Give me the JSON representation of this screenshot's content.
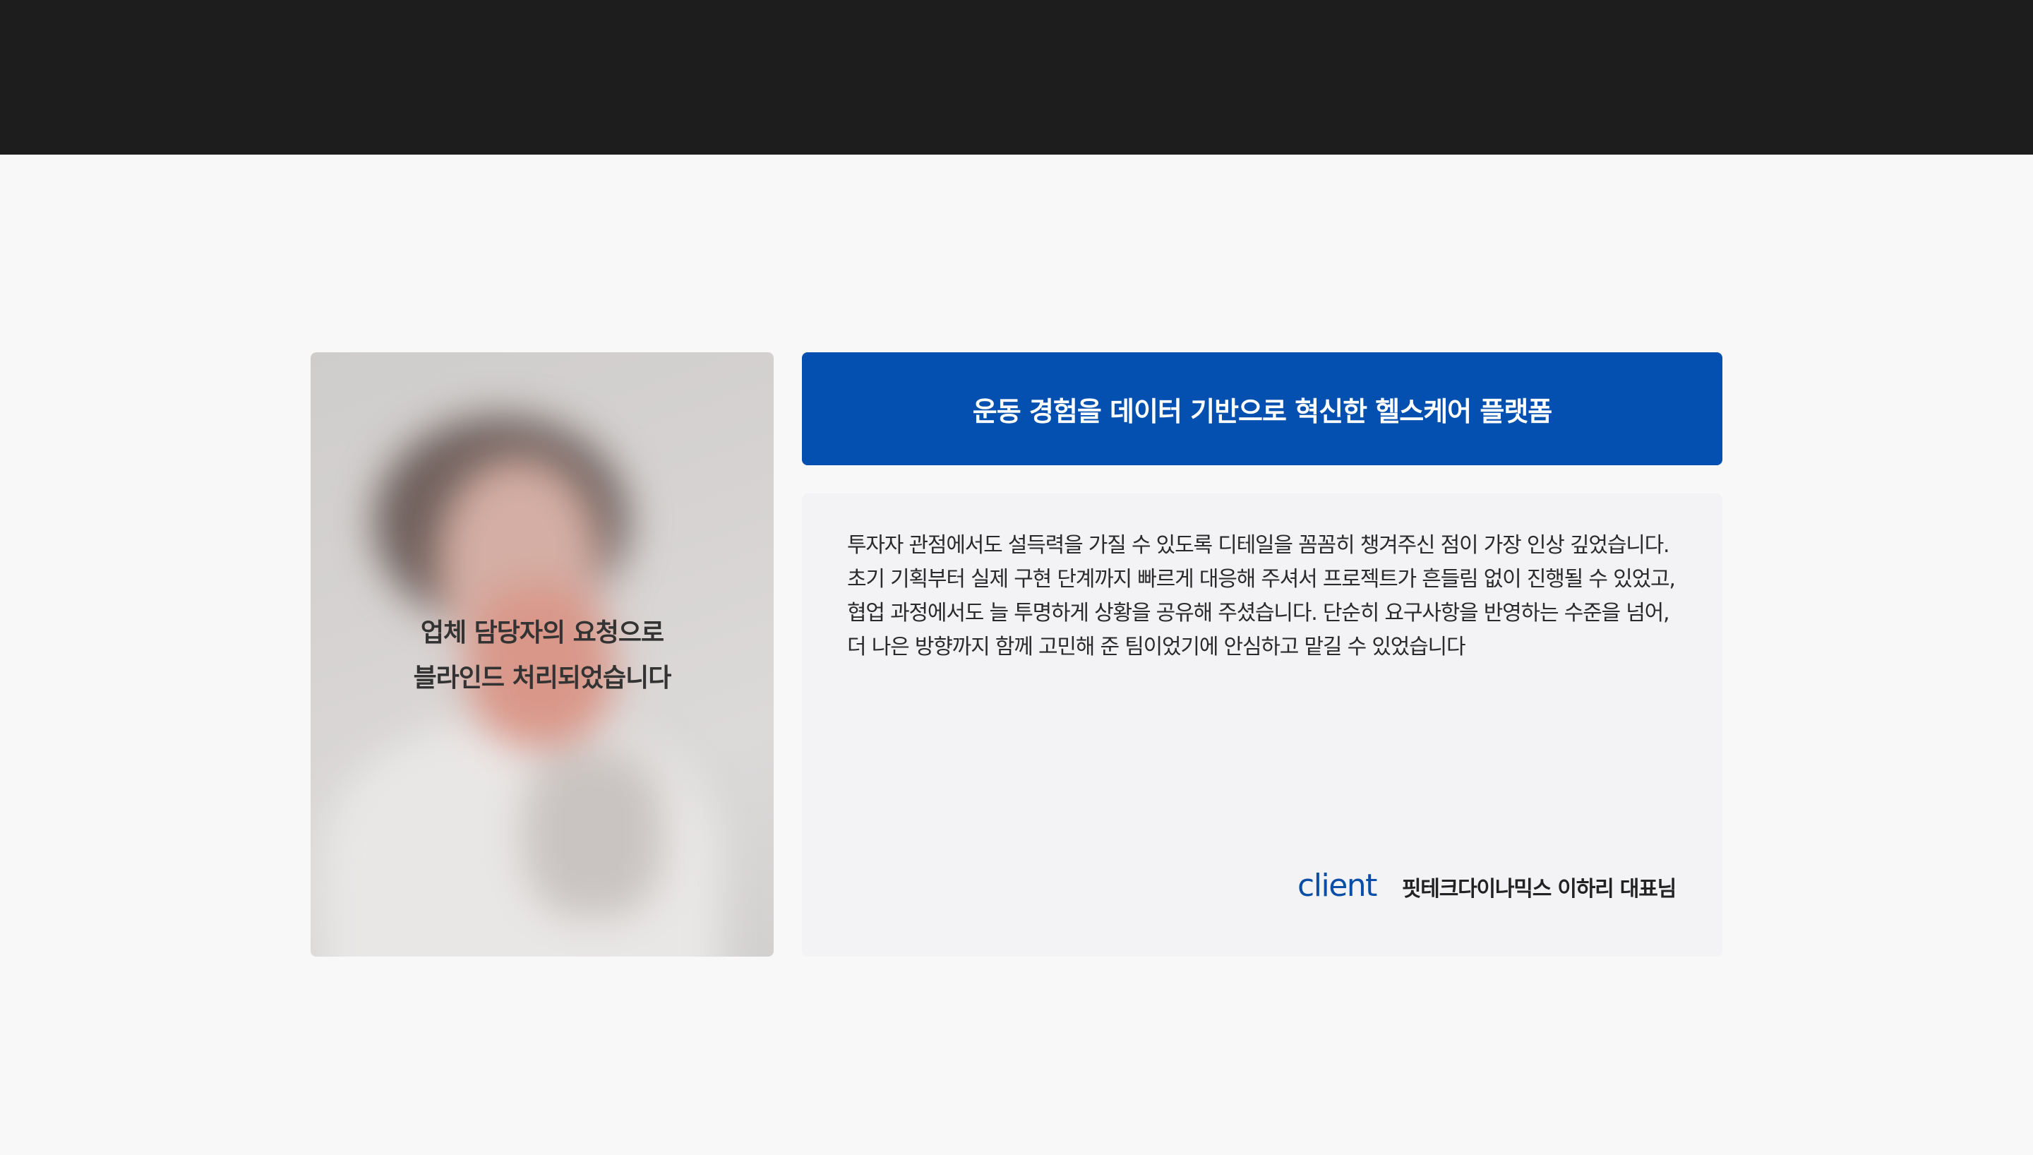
{
  "photo": {
    "notice_line1": "업체 담당자의 요청으로",
    "notice_line2": "블라인드 처리되었습니다"
  },
  "banner": {
    "title": "운동 경험을 데이터 기반으로 혁신한 헬스케어 플랫폼"
  },
  "review": {
    "lines": [
      "투자자 관점에서도 설득력을 가질 수 있도록 디테일을 꼼꼼히 챙겨주신 점이 가장 인상 깊었습니다.",
      "초기 기획부터 실제 구현 단계까지 빠르게 대응해 주셔서 프로젝트가 흔들림 없이 진행될 수 있었고,",
      "협업 과정에서도 늘 투명하게 상황을 공유해 주셨습니다. 단순히 요구사항을 반영하는 수준을 넘어,",
      "더 나은 방향까지 함께 고민해 준 팀이었기에 안심하고 맡길 수 있었습니다"
    ],
    "client_label": "client",
    "client_name": "핏테크다이나믹스 이하리 대표님"
  },
  "colors": {
    "header_bg": "#1d1d1d",
    "page_bg": "#f8f8f8",
    "banner_bg": "#0350b0",
    "card_bg": "#f3f3f5",
    "accent": "#0a4ea8"
  }
}
